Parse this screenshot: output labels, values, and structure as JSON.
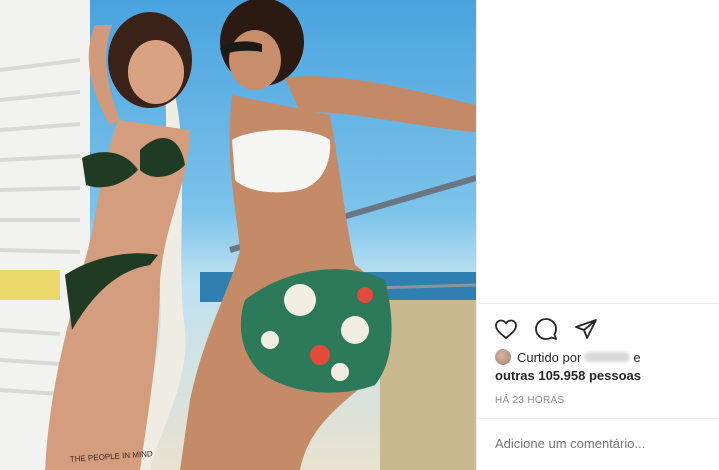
{
  "post": {
    "likes": {
      "prefix": "Curtido por",
      "connector": "e",
      "others": "outras 105.958 pessoas"
    },
    "timestamp": "HÁ 23 HORAS",
    "comment_placeholder": "Adicione um comentário..."
  },
  "photo": {
    "tattoo_text": "THE PEOPLE IN MIND"
  },
  "icons": {
    "like": "heart-icon",
    "comment": "comment-icon",
    "share": "paper-plane-icon"
  }
}
